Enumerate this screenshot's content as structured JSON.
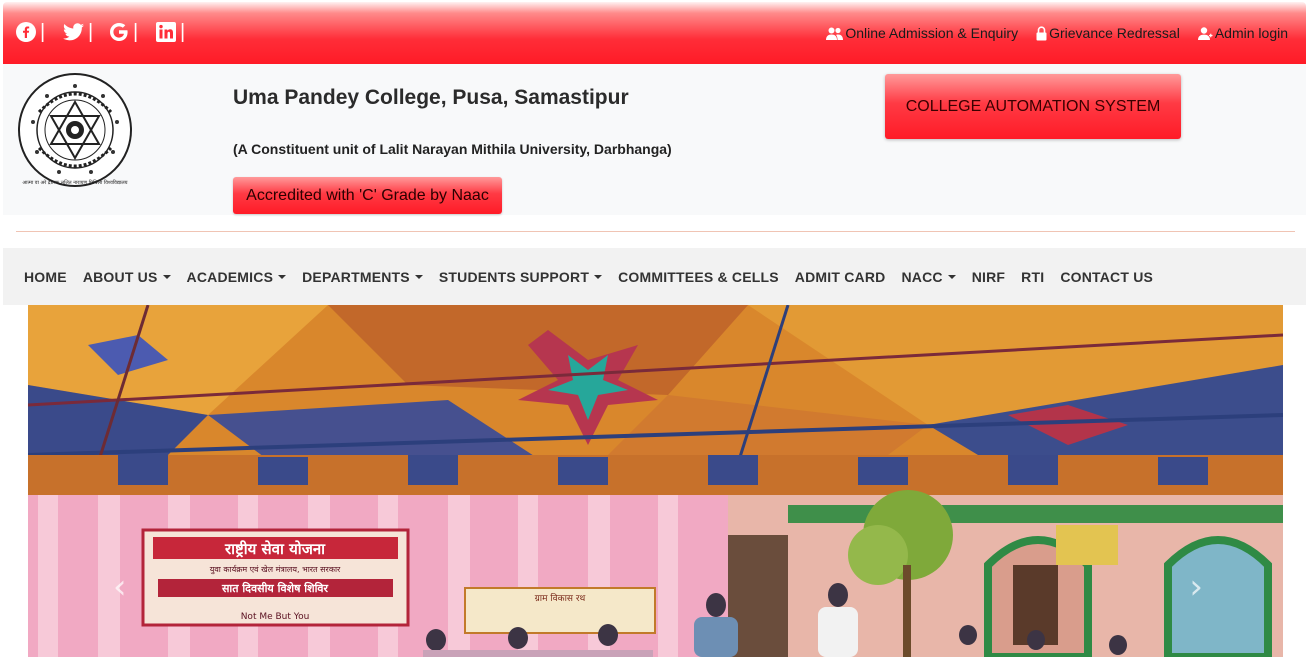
{
  "colors": {
    "topbar": "#ff1b27",
    "navText": "#333333",
    "accent": "#ff3a44"
  },
  "social": [
    {
      "icon": "facebook-icon",
      "sep": "|"
    },
    {
      "icon": "twitter-icon",
      "sep": "|"
    },
    {
      "icon": "google-icon",
      "sep": "|"
    },
    {
      "icon": "linkedin-icon",
      "sep": "|"
    }
  ],
  "toplinks": {
    "admission": "Online Admission & Enquiry",
    "grievance": "Grievance Redressal",
    "admin": "Admin login"
  },
  "header": {
    "title": "Uma Pandey College, Pusa, Samastipur",
    "subtitle": "(A Constituent unit of Lalit Narayan Mithila University, Darbhanga)",
    "naac": "Accredited with 'C' Grade by Naac",
    "cas_button": "COLLEGE AUTOMATION SYSTEM",
    "logo_text": "आत्मा वा अरे द्रष्टव्यः ललित नारायण मिथिला विश्वविद्यालय"
  },
  "nav": {
    "home": "HOME",
    "about": "ABOUT US",
    "academics": "ACADEMICS",
    "departments": "DEPARTMENTS",
    "students": "STUDENTS SUPPORT",
    "committees": "COMMITTEES & CELLS",
    "admit": "ADMIT CARD",
    "nacc": "NACC",
    "nirf": "NIRF",
    "rti": "RTI",
    "contact": "CONTACT US"
  },
  "slider": {
    "banner_line1": "राष्ट्रीय सेवा योजना",
    "banner_line2": "युवा कार्यक्रम एवं खेल मंत्रालय, भारत सरकार",
    "banner_line3": "सात दिवसीय विशेष शिविर",
    "banner_line4": "Not Me But You",
    "banner2": "ग्राम विकास रथ",
    "prev": "‹",
    "next": "›"
  }
}
